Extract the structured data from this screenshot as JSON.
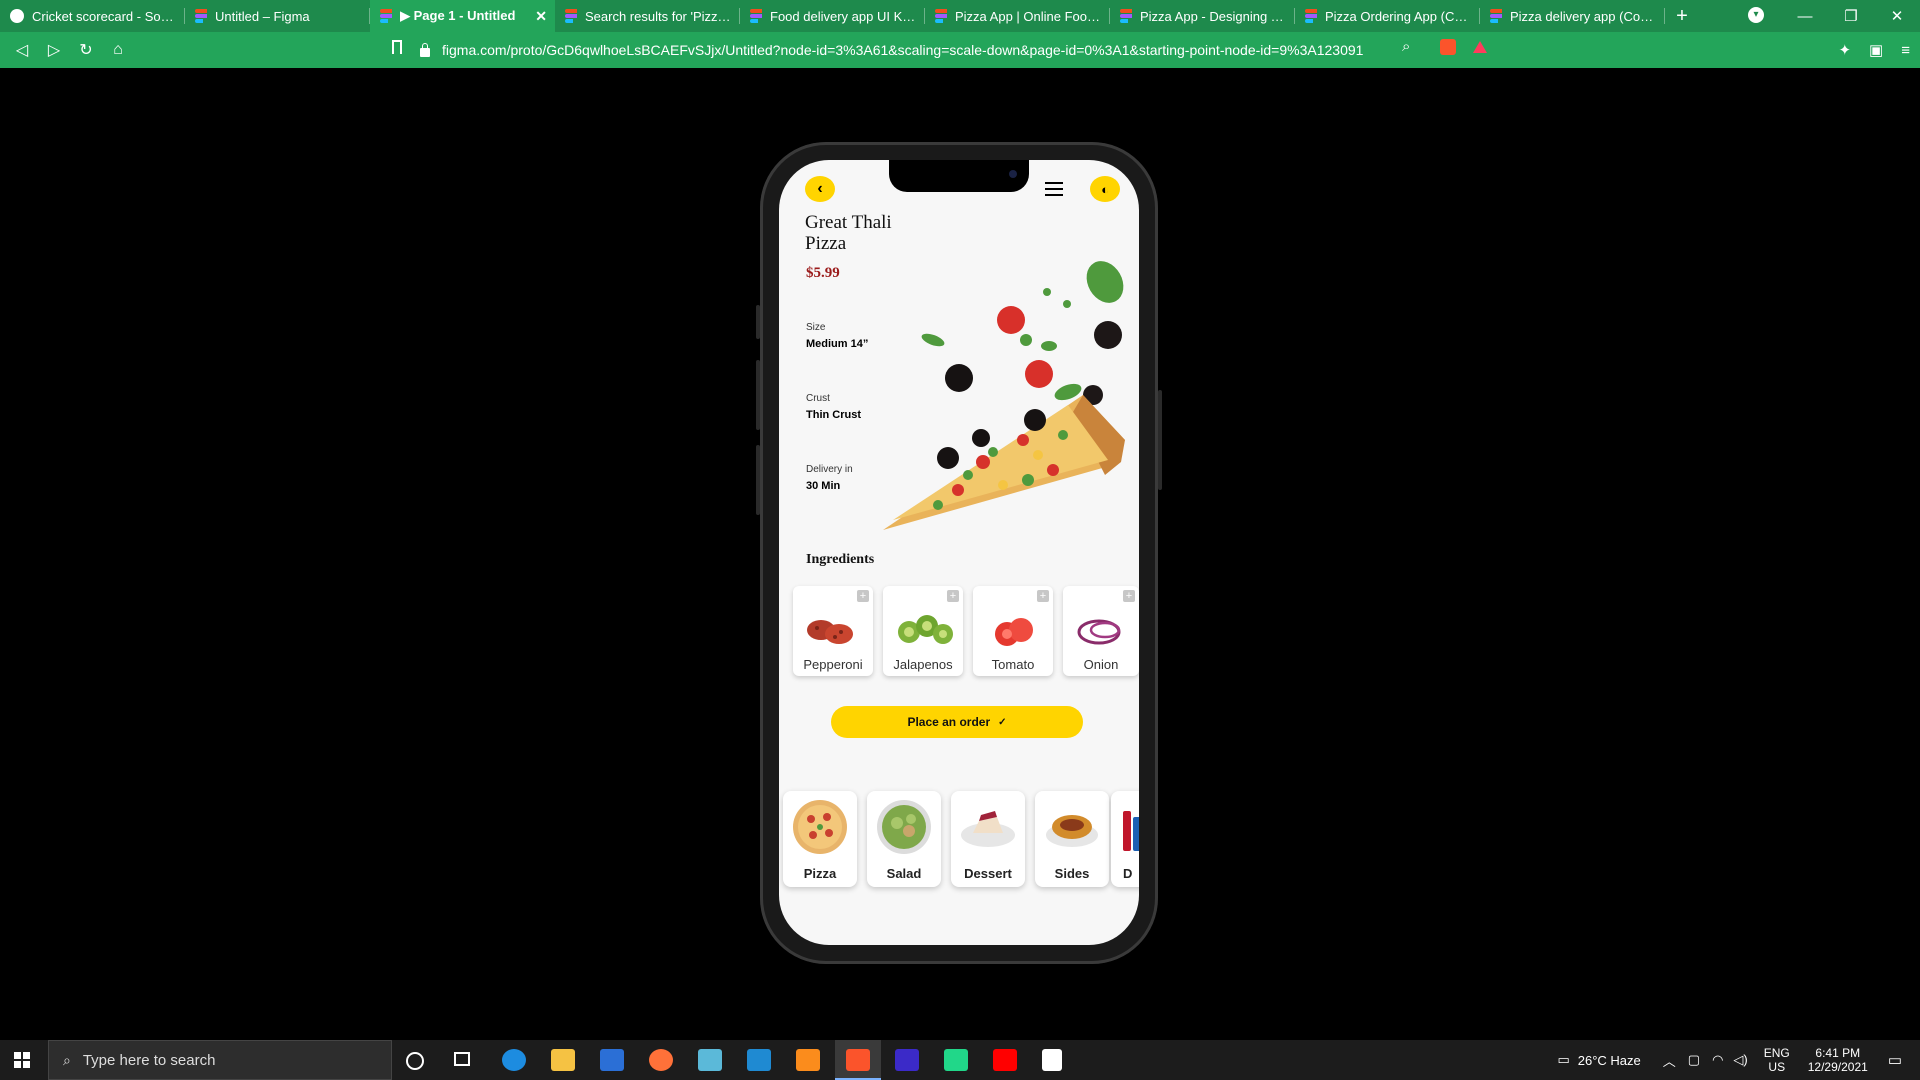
{
  "browser": {
    "tabs": [
      {
        "title": "Cricket scorecard - South Af",
        "favicon": "cricket-icon"
      },
      {
        "title": "Untitled – Figma",
        "favicon": "figma-icon"
      },
      {
        "title": "▶ Page 1 - Untitled",
        "favicon": "figma-icon",
        "active": true
      },
      {
        "title": "Search results for 'Pizza foo",
        "favicon": "figma-icon"
      },
      {
        "title": "Food delivery app UI Kit (Co",
        "favicon": "figma-icon"
      },
      {
        "title": "Pizza App | Online Food Del",
        "favicon": "figma-icon"
      },
      {
        "title": "Pizza App - Designing Your",
        "favicon": "figma-icon"
      },
      {
        "title": "Pizza Ordering App (Comm",
        "favicon": "figma-icon"
      },
      {
        "title": "Pizza delivery app (Commun",
        "favicon": "figma-icon"
      }
    ],
    "url": "figma.com/proto/GcD6qwlhoeLsBCAEFvSJjx/Untitled?node-id=3%3A61&scaling=scale-down&page-id=0%3A1&starting-point-node-id=9%3A123091",
    "brave_badge": "5"
  },
  "app": {
    "product": {
      "name": "Great Thali Pizza",
      "price": "$5.99"
    },
    "specs": [
      {
        "label": "Size",
        "value": "Medium 14”"
      },
      {
        "label": "Crust",
        "value": "Thin Crust"
      },
      {
        "label": "Delivery in",
        "value": "30 Min"
      }
    ],
    "ingredients_title": "Ingredients",
    "ingredients": [
      {
        "name": "Pepperoni"
      },
      {
        "name": "Jalapenos"
      },
      {
        "name": "Tomato"
      },
      {
        "name": "Onion"
      }
    ],
    "order_button": "Place an order",
    "categories": [
      {
        "name": "Pizza"
      },
      {
        "name": "Salad"
      },
      {
        "name": "Dessert"
      },
      {
        "name": "Sides"
      },
      {
        "name": "D"
      }
    ],
    "colors": {
      "accent": "#ffd400",
      "price": "#9b1b1b",
      "screen_bg": "#f7f7f7"
    }
  },
  "taskbar": {
    "search_placeholder": "Type here to search",
    "weather": "26°C  Haze",
    "lang": "ENG",
    "region": "US",
    "time": "6:41 PM",
    "date": "12/29/2021"
  }
}
